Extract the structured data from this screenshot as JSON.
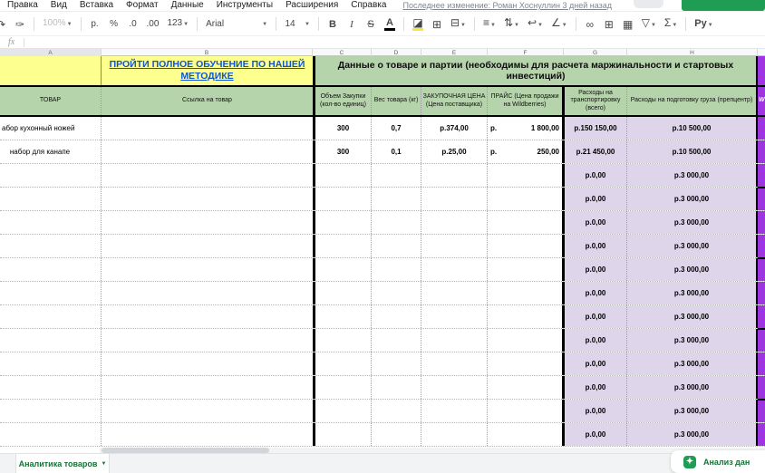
{
  "menubar": {
    "items": [
      "Правка",
      "Вид",
      "Вставка",
      "Формат",
      "Данные",
      "Инструменты",
      "Расширения",
      "Справка"
    ],
    "last_edited": "Последнее изменение: Роман Хоснуллин 3 дней назад"
  },
  "toolbar": {
    "zoom": "100%",
    "currency_format": "р.",
    "percent_format": "%",
    "decrease_decimals": ".0",
    "increase_decimals": ".00",
    "more_formats": "123",
    "font_name": "Arial",
    "font_size": "14",
    "bold": "B",
    "italic": "I",
    "strikethrough": "S",
    "text_color": "A",
    "functions": "Σ",
    "custom_button": "Ру"
  },
  "formula_bar": {
    "fx_label": "fx",
    "value": ""
  },
  "column_headers": [
    "A",
    "B",
    "C",
    "D",
    "E",
    "F",
    "G",
    "H"
  ],
  "sheet": {
    "row1": {
      "course_link": "ПРОЙТИ ПОЛНОЕ ОБУЧЕНИЕ ПО НАШЕЙ МЕТОДИКЕ",
      "section_title": "Данные о товаре и партии (необходимы для расчета маржинальности и стартовых инвестиций)"
    },
    "headers": {
      "a": "ТОВАР",
      "b": "Ссылка на товар",
      "c": "Объем Закупки (кол-во единиц)",
      "d": "Вес товара (кг)",
      "e": "ЗАКУПОЧНАЯ ЦЕНА (Цена поставщика)",
      "f": "ПРАЙС (Цена продажи на Wildberries)",
      "g": "Расходы на транспортировку (всего)",
      "h": "Расходы на подготовку груза (препцентр)",
      "i": "W"
    },
    "rows": [
      {
        "a": "абор кухонный ножей",
        "c": "300",
        "d": "0,7",
        "e": "р.374,00",
        "f_cur": "р.",
        "f_val": "1 800,00",
        "g": "р.150 150,00",
        "h": "р.10 500,00"
      },
      {
        "a": "    набор для канапе",
        "c": "300",
        "d": "0,1",
        "e": "р.25,00",
        "f_cur": "р.",
        "f_val": "250,00",
        "g": "р.21 450,00",
        "h": "р.10 500,00"
      },
      {
        "a": "",
        "c": "",
        "d": "",
        "e": "",
        "f_cur": "",
        "f_val": "",
        "g": "р.0,00",
        "h": "р.3 000,00"
      },
      {
        "a": "",
        "c": "",
        "d": "",
        "e": "",
        "f_cur": "",
        "f_val": "",
        "g": "р.0,00",
        "h": "р.3 000,00"
      },
      {
        "a": "",
        "c": "",
        "d": "",
        "e": "",
        "f_cur": "",
        "f_val": "",
        "g": "р.0,00",
        "h": "р.3 000,00"
      },
      {
        "a": "",
        "c": "",
        "d": "",
        "e": "",
        "f_cur": "",
        "f_val": "",
        "g": "р.0,00",
        "h": "р.3 000,00"
      },
      {
        "a": "",
        "c": "",
        "d": "",
        "e": "",
        "f_cur": "",
        "f_val": "",
        "g": "р.0,00",
        "h": "р.3 000,00"
      },
      {
        "a": "",
        "c": "",
        "d": "",
        "e": "",
        "f_cur": "",
        "f_val": "",
        "g": "р.0,00",
        "h": "р.3 000,00"
      },
      {
        "a": "",
        "c": "",
        "d": "",
        "e": "",
        "f_cur": "",
        "f_val": "",
        "g": "р.0,00",
        "h": "р.3 000,00"
      },
      {
        "a": "",
        "c": "",
        "d": "",
        "e": "",
        "f_cur": "",
        "f_val": "",
        "g": "р.0,00",
        "h": "р.3 000,00"
      },
      {
        "a": "",
        "c": "",
        "d": "",
        "e": "",
        "f_cur": "",
        "f_val": "",
        "g": "р.0,00",
        "h": "р.3 000,00"
      },
      {
        "a": "",
        "c": "",
        "d": "",
        "e": "",
        "f_cur": "",
        "f_val": "",
        "g": "р.0,00",
        "h": "р.3 000,00"
      },
      {
        "a": "",
        "c": "",
        "d": "",
        "e": "",
        "f_cur": "",
        "f_val": "",
        "g": "р.0,00",
        "h": "р.3 000,00"
      },
      {
        "a": "",
        "c": "",
        "d": "",
        "e": "",
        "f_cur": "",
        "f_val": "",
        "g": "р.0,00",
        "h": "р.3 000,00"
      }
    ]
  },
  "tab_bar": {
    "active_tab": "Аналитика товаров",
    "explore_label": "Анализ дан"
  },
  "colors": {
    "yellow": "#fdff8e",
    "green": "#b6d4ab",
    "lavender": "#ded5ea",
    "purple": "#9d36e0",
    "link_blue": "#1155cc",
    "tab_green": "#137333",
    "share_green": "#1f9d55"
  }
}
